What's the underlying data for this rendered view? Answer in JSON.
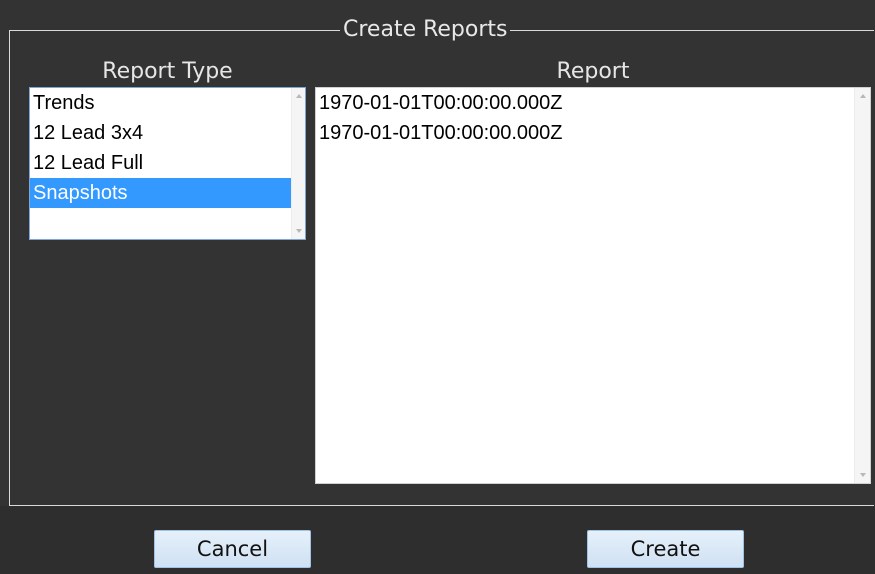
{
  "dialog": {
    "title": "Create Reports"
  },
  "report_type": {
    "label": "Report Type",
    "items": [
      {
        "label": "Trends",
        "selected": false
      },
      {
        "label": "12 Lead 3x4",
        "selected": false
      },
      {
        "label": "12 Lead Full",
        "selected": false
      },
      {
        "label": "Snapshots",
        "selected": true
      }
    ]
  },
  "report": {
    "label": "Report",
    "items": [
      {
        "label": "1970-01-01T00:00:00.000Z"
      },
      {
        "label": "1970-01-01T00:00:00.000Z"
      }
    ]
  },
  "buttons": {
    "cancel_label": "Cancel",
    "create_label": "Create"
  },
  "colors": {
    "background": "#333333",
    "selection": "#3399ff",
    "button_fill": "#d9e8f6",
    "button_border": "#9ec3e6",
    "list_focus_border": "#7ea6d8"
  },
  "icons": {
    "scroll_up": "scroll-up-arrow-icon",
    "scroll_down": "scroll-down-arrow-icon"
  }
}
